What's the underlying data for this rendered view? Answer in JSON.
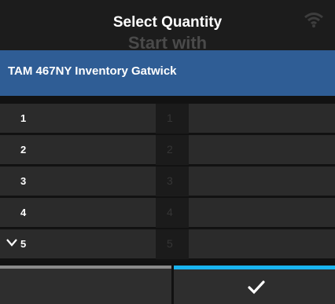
{
  "header": {
    "title": "Select Quantity",
    "ghost_title": "Start with",
    "wifi_icon": "wifi-icon"
  },
  "selected": {
    "label": "TAM 467NY Inventory Gatwick"
  },
  "list": {
    "items": [
      {
        "label": "1",
        "ghost": "1"
      },
      {
        "label": "2",
        "ghost": "2"
      },
      {
        "label": "3",
        "ghost": "3"
      },
      {
        "label": "4",
        "ghost": "4"
      },
      {
        "label": "5",
        "ghost": "5"
      }
    ],
    "scroll_icon": "chevron-down-icon"
  },
  "footer": {
    "confirm_icon": "checkmark-icon"
  },
  "colors": {
    "accent": "#19b4f0",
    "selected_bg": "#2f5d95"
  }
}
